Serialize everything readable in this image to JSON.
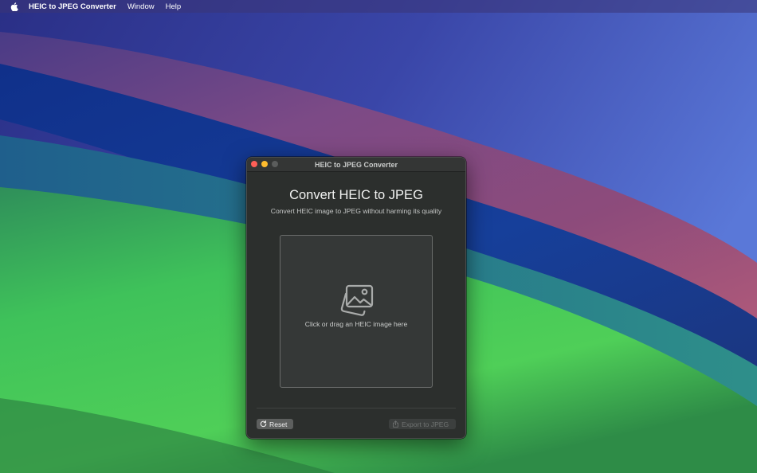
{
  "menubar": {
    "apple_icon": "apple-logo-icon",
    "app_name": "HEIC to JPEG Converter",
    "items": [
      {
        "label": "Window"
      },
      {
        "label": "Help"
      }
    ]
  },
  "window": {
    "title": "HEIC to JPEG Converter",
    "heading": "Convert HEIC to JPEG",
    "subheading": "Convert HEIC image to JPEG without harming its quality",
    "dropzone": {
      "icon": "photo-stack-icon",
      "label": "Click or drag an HEIC image here"
    },
    "buttons": {
      "reset": {
        "label": "Reset",
        "icon": "reset-arrow-icon"
      },
      "export": {
        "label": "Export to JPEG",
        "icon": "share-icon",
        "enabled": false
      }
    }
  },
  "colors": {
    "window_bg": "#2c2f2d",
    "close": "#fe5f57",
    "minimize": "#febc2e",
    "zoom_disabled": "#5b5d5c"
  }
}
